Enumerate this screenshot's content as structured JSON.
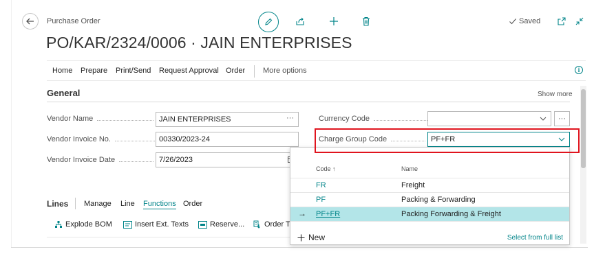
{
  "header": {
    "page_type": "Purchase Order",
    "title": "PO/KAR/2324/0006 · JAIN ENTERPRISES",
    "saved_status": "Saved"
  },
  "menu": {
    "items": [
      "Home",
      "Prepare",
      "Print/Send",
      "Request Approval",
      "Order"
    ],
    "more_options": "More options"
  },
  "general": {
    "title": "General",
    "show_more": "Show more",
    "vendor_name_label": "Vendor Name",
    "vendor_name_value": "JAIN ENTERPRISES",
    "vendor_invoice_no_label": "Vendor Invoice No.",
    "vendor_invoice_no_value": "00330/2023-24",
    "vendor_invoice_date_label": "Vendor Invoice Date",
    "vendor_invoice_date_value": "7/26/2023",
    "currency_code_label": "Currency Code",
    "currency_code_value": "",
    "charge_group_code_label": "Charge Group Code",
    "charge_group_code_value": "PF+FR"
  },
  "lookup": {
    "col_code": "Code ↑",
    "col_name": "Name",
    "rows": [
      {
        "code": "FR",
        "name": "Freight"
      },
      {
        "code": "PF",
        "name": "Packing & Forwarding"
      },
      {
        "code": "PF+FR",
        "name": "Packing Forwarding & Freight"
      }
    ],
    "selected_index": 2,
    "new_label": "New",
    "select_full_list": "Select from full list"
  },
  "lines": {
    "title": "Lines",
    "tabs": [
      "Manage",
      "Line",
      "Functions",
      "Order"
    ],
    "active_tab": "Functions",
    "actions": [
      "Explode BOM",
      "Insert Ext. Texts",
      "Reserve...",
      "Order Tr"
    ]
  },
  "colors": {
    "accent": "#008489",
    "selection": "#b3e5e8",
    "highlight": "#e0141e"
  }
}
